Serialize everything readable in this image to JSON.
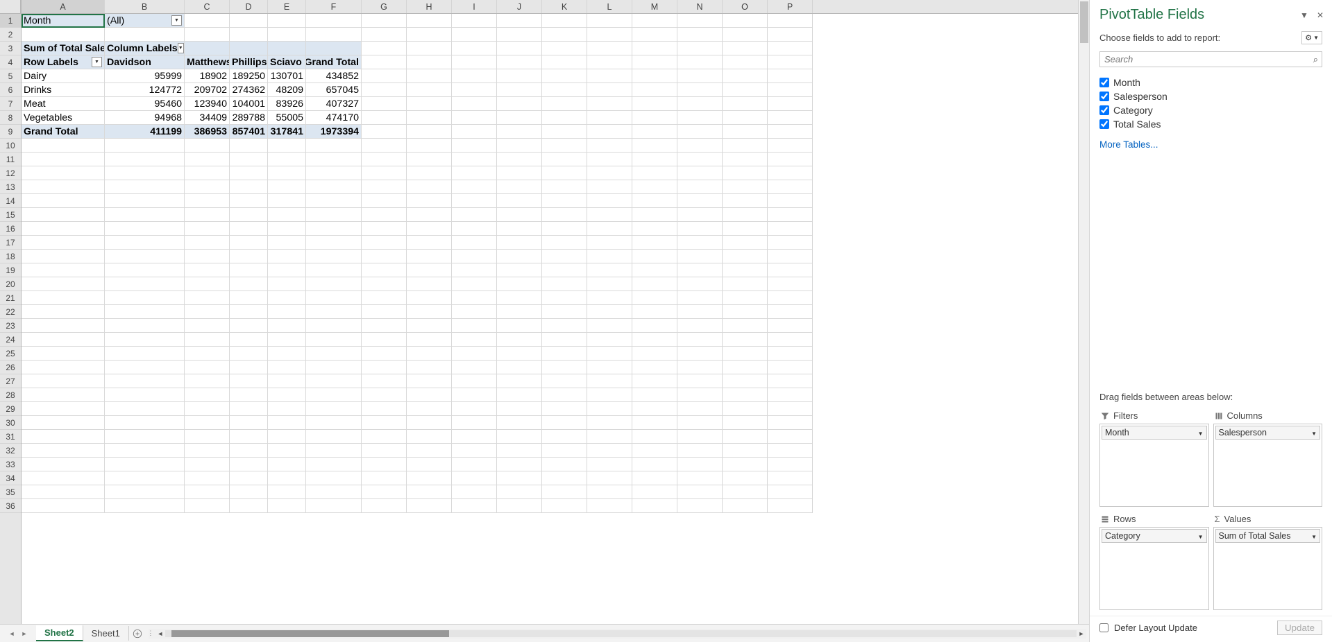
{
  "cols": {
    "letters": [
      "A",
      "B",
      "C",
      "D",
      "E",
      "F",
      "G",
      "H",
      "I",
      "J",
      "K",
      "L",
      "M",
      "N",
      "O",
      "P"
    ],
    "widths": [
      120,
      115,
      65,
      55,
      55,
      80,
      65,
      65,
      65,
      65,
      65,
      65,
      65,
      65,
      65,
      65
    ]
  },
  "rowcount": 36,
  "pivot": {
    "filter_label": "Month",
    "filter_value": "(All)",
    "value_hdr": "Sum of Total Sales",
    "col_hdr": "Column Labels",
    "row_hdr": "Row Labels",
    "cols": [
      "Davidson",
      "Matthews",
      "Phillips",
      "Sciavo",
      "Grand Total"
    ],
    "rows": [
      {
        "label": "Dairy",
        "v": [
          "95999",
          "18902",
          "189250",
          "130701",
          "434852"
        ]
      },
      {
        "label": "Drinks",
        "v": [
          "124772",
          "209702",
          "274362",
          "48209",
          "657045"
        ]
      },
      {
        "label": "Meat",
        "v": [
          "95460",
          "123940",
          "104001",
          "83926",
          "407327"
        ]
      },
      {
        "label": "Vegetables",
        "v": [
          "94968",
          "34409",
          "289788",
          "55005",
          "474170"
        ]
      }
    ],
    "grand": {
      "label": "Grand Total",
      "v": [
        "411199",
        "386953",
        "857401",
        "317841",
        "1973394"
      ]
    }
  },
  "tabs": {
    "active": "Sheet2",
    "other": "Sheet1"
  },
  "panel": {
    "title": "PivotTable Fields",
    "sub": "Choose fields to add to report:",
    "search_ph": "Search",
    "fields": [
      "Month",
      "Salesperson",
      "Category",
      "Total Sales"
    ],
    "more": "More Tables...",
    "dragtxt": "Drag fields between areas below:",
    "areas": {
      "filters": {
        "label": "Filters",
        "chips": [
          "Month"
        ]
      },
      "columns": {
        "label": "Columns",
        "chips": [
          "Salesperson"
        ]
      },
      "rows": {
        "label": "Rows",
        "chips": [
          "Category"
        ]
      },
      "values": {
        "label": "Values",
        "chips": [
          "Sum of Total Sales"
        ]
      }
    },
    "defer": "Defer Layout Update",
    "update": "Update"
  }
}
